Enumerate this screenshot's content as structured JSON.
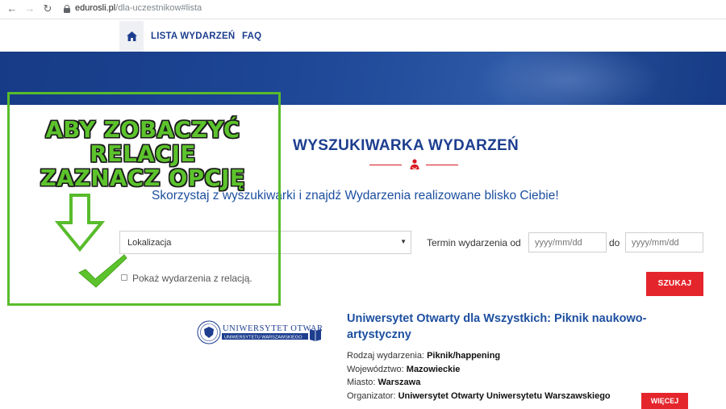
{
  "browser": {
    "url_domain": "edurosli.pl",
    "url_path": "/dla-uczestnikow#lista"
  },
  "nav": {
    "home_icon": "home-icon",
    "items": [
      {
        "label": "LISTA WYDARZEŃ"
      },
      {
        "label": "FAQ"
      }
    ]
  },
  "main": {
    "heading": "WYSZUKIWARKA WYDARZEŃ",
    "subtitle": "Skorzystaj z wyszukiwarki i znajdź Wydarzenia realizowane blisko Ciebie!"
  },
  "search": {
    "location_value": "Lokalizacja",
    "date_label": "Termin wydarzenia od",
    "date_from_placeholder": "yyyy/mm/dd",
    "date_sep": "do",
    "date_to_placeholder": "yyyy/mm/dd",
    "checkbox_label": "Pokaż wydarzenia z relacją.",
    "submit_label": "SZUKAJ"
  },
  "annotation": {
    "line1": "ABY ZOBACZYĆ",
    "line2": "RELACJE",
    "line3": "ZAZNACZ OPCJĘ",
    "color": "#5cc32c"
  },
  "event": {
    "logo_line1": "UNIWERSYTET OTWARTY",
    "logo_line2": "UNIWERSYTETU WARSZAWSKIEGO",
    "title": "Uniwersytet Otwarty dla Wszystkich: Piknik naukowo-artystyczny",
    "type_label": "Rodzaj wydarzenia:",
    "type_value": "Piknik/happening",
    "voivodeship_label": "Województwo:",
    "voivodeship_value": "Mazowieckie",
    "city_label": "Miasto:",
    "city_value": "Warszawa",
    "organizer_label": "Organizator:",
    "organizer_value": "Uniwersytet Otwarty Uniwersytetu Warszawskiego",
    "more_label": "WIĘCEJ"
  },
  "colors": {
    "brand_blue": "#1d3e8f",
    "accent_red": "#e4262c",
    "annotation_green": "#58bb2b"
  }
}
